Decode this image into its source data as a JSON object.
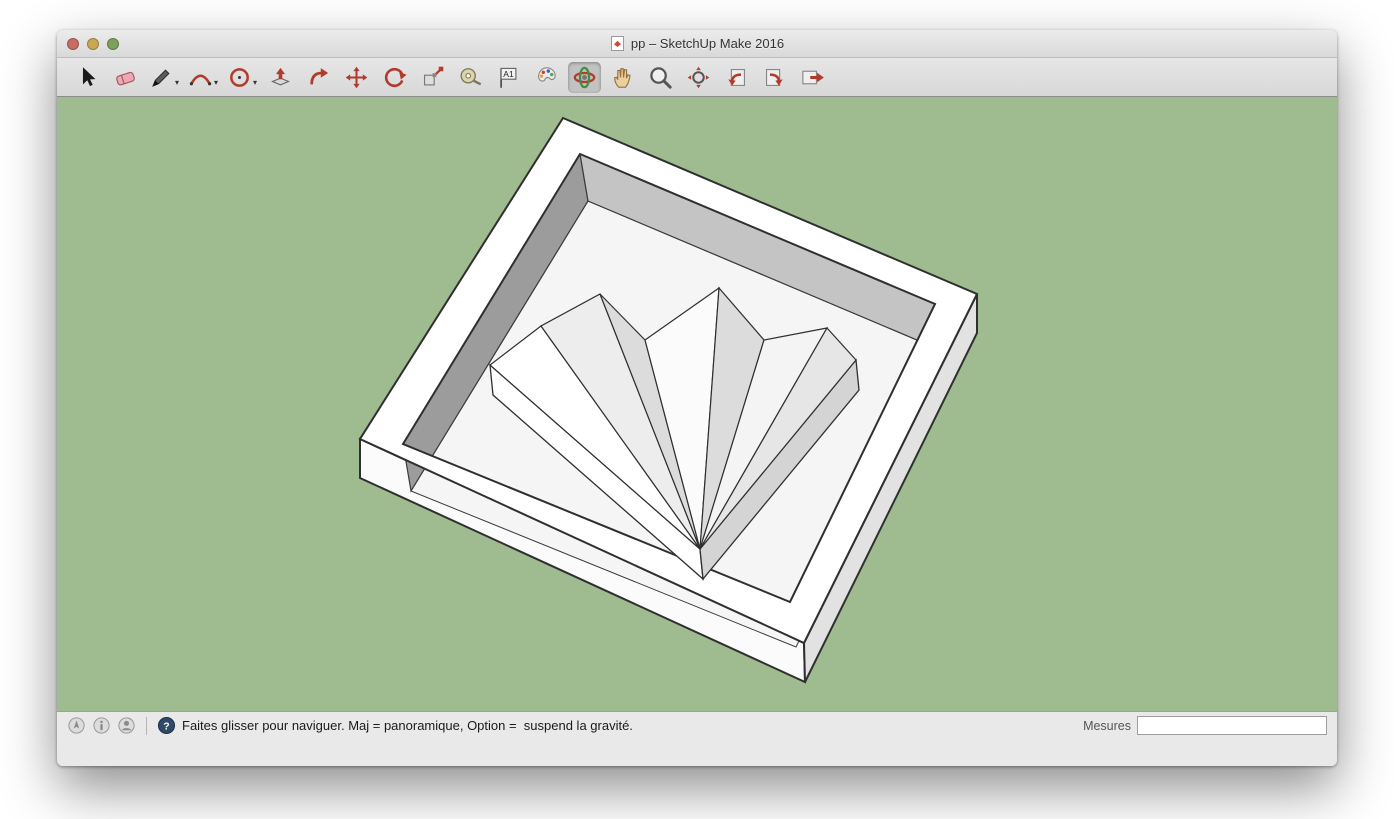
{
  "window": {
    "title": "pp – SketchUp Make 2016",
    "traffic_lights": [
      {
        "id": "close",
        "color": "#c96d63"
      },
      {
        "id": "minimize",
        "color": "#c9a852"
      },
      {
        "id": "zoom",
        "color": "#7fa05c"
      }
    ]
  },
  "toolbar": {
    "tools": [
      {
        "id": "select",
        "selected": false,
        "dropdown": false
      },
      {
        "id": "eraser",
        "selected": false,
        "dropdown": false
      },
      {
        "id": "line",
        "selected": false,
        "dropdown": true
      },
      {
        "id": "arc",
        "selected": false,
        "dropdown": true
      },
      {
        "id": "circle",
        "selected": false,
        "dropdown": true
      },
      {
        "id": "push-pull",
        "selected": false,
        "dropdown": false
      },
      {
        "id": "follow-me",
        "selected": false,
        "dropdown": false
      },
      {
        "id": "move",
        "selected": false,
        "dropdown": false
      },
      {
        "id": "rotate",
        "selected": false,
        "dropdown": false
      },
      {
        "id": "scale",
        "selected": false,
        "dropdown": false
      },
      {
        "id": "tape-measure",
        "selected": false,
        "dropdown": false
      },
      {
        "id": "text",
        "selected": false,
        "dropdown": false
      },
      {
        "id": "paint-bucket",
        "selected": false,
        "dropdown": false
      },
      {
        "id": "orbit",
        "selected": true,
        "dropdown": false
      },
      {
        "id": "pan",
        "selected": false,
        "dropdown": false
      },
      {
        "id": "zoom",
        "selected": false,
        "dropdown": false
      },
      {
        "id": "zoom-extents",
        "selected": false,
        "dropdown": false
      },
      {
        "id": "previous-view",
        "selected": false,
        "dropdown": false
      },
      {
        "id": "next-view",
        "selected": false,
        "dropdown": false
      },
      {
        "id": "export-model",
        "selected": false,
        "dropdown": false
      }
    ]
  },
  "viewport": {
    "background_color": "#9fbb90",
    "model_colors": {
      "face": "#ffffff",
      "floor": "#f5f5f5",
      "inner_wall_dark": "#9c9c9c",
      "inner_wall_medium": "#c4c4c4",
      "outer_wall_shaded": "#e2e2e2",
      "edge": "#2f2f2f"
    }
  },
  "statusbar": {
    "icons": [
      {
        "id": "geolocation"
      },
      {
        "id": "credits"
      },
      {
        "id": "sign-in"
      },
      {
        "id": "help"
      }
    ],
    "message": "Faites glisser pour naviguer. Maj = panoramique, Option =  suspend la gravité.",
    "measurements": {
      "label": "Mesures",
      "value": ""
    }
  }
}
